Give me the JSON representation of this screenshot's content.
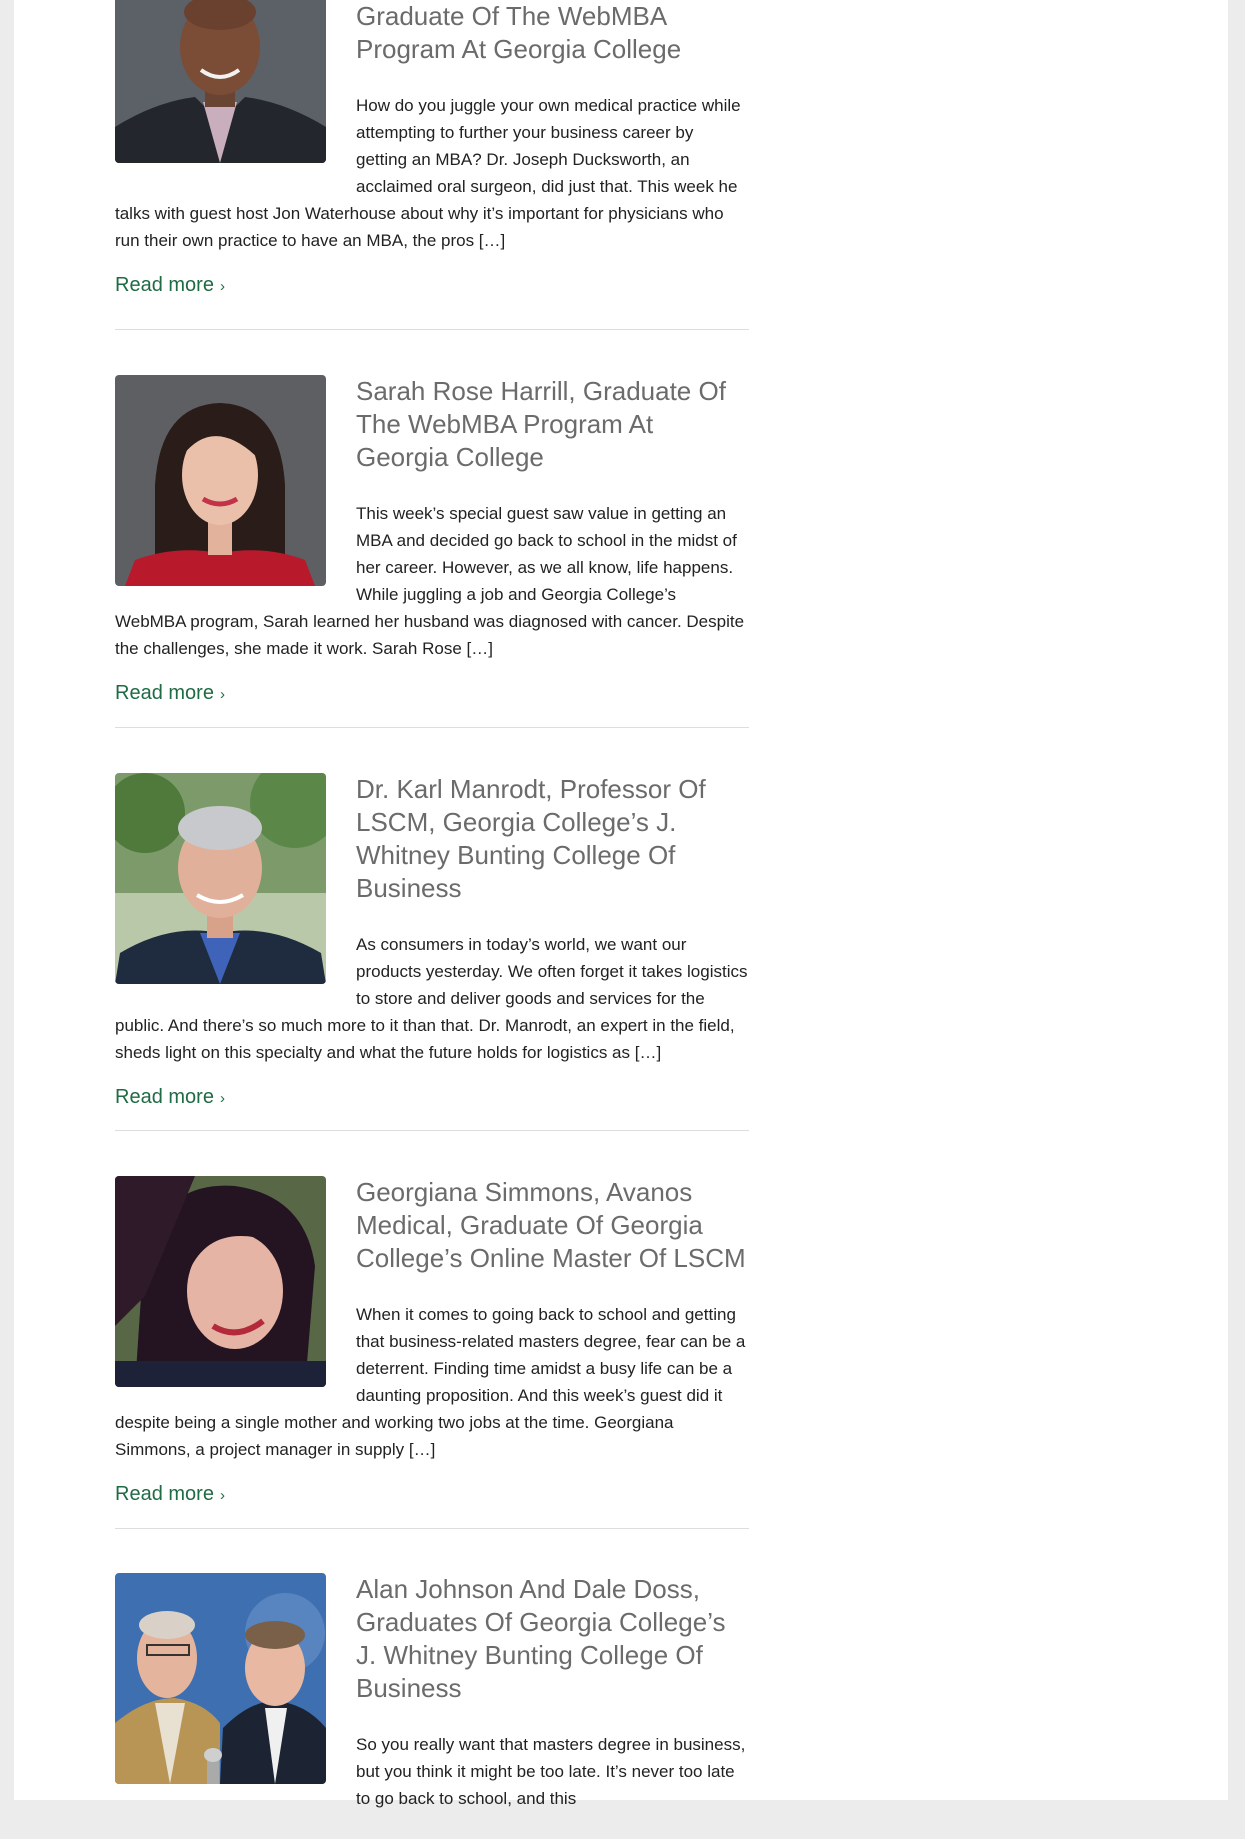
{
  "posts": [
    {
      "title": "Graduate Of The WebMBA Program At Georgia College",
      "excerpt": "How do you juggle your own medical practice while attempting to further your business career by getting an MBA? Dr. Joseph Ducksworth, an acclaimed oral surgeon, did just that. This week he talks with guest host Jon Waterhouse about why it’s important for physicians who run their own practice to have an MBA, the pros […]",
      "read_more": "Read more",
      "photo": "portrait-man-suit"
    },
    {
      "title": "Sarah Rose Harrill, Graduate Of The WebMBA Program At Georgia College",
      "excerpt": "This week’s special guest saw value in getting an MBA and decided go back to school in the midst of her career. However, as we all know, life happens. While juggling a job and Georgia College’s WebMBA program, Sarah learned her husband was diagnosed with cancer. Despite the challenges, she made it work. Sarah Rose […]",
      "read_more": "Read more",
      "photo": "portrait-woman-red"
    },
    {
      "title": "Dr. Karl Manrodt, Professor Of LSCM, Georgia College’s J. Whitney Bunting College Of Business",
      "excerpt": "As consumers in today’s world, we want our products yesterday. We often forget it takes logistics to store and deliver goods and services for the public. And there’s so much more to it than that. Dr. Manrodt, an expert in the field, sheds light on this specialty and what the future holds for logistics as […]",
      "read_more": "Read more",
      "photo": "portrait-man-outdoors"
    },
    {
      "title": "Georgiana Simmons, Avanos Medical, Graduate Of Georgia College’s Online Master Of LSCM",
      "excerpt": "When it comes to going back to school and getting that business-related masters degree, fear can be a deterrent. Finding time amidst a busy life can be a daunting proposition. And this week’s guest did it despite being a single mother and working two jobs at the time. Georgiana Simmons, a project manager in supply […]",
      "read_more": "Read more",
      "photo": "portrait-woman-smiling"
    },
    {
      "title": "Alan Johnson And Dale Doss, Graduates Of Georgia College’s J. Whitney Bunting College Of Business",
      "excerpt": "So you really want that masters degree in business, but you think it might be too late. It’s never too late to go back to school, and this",
      "read_more": "",
      "photo": "portrait-two-men"
    }
  ],
  "colors": {
    "accent_green": "#1f6b43",
    "title_gray": "#6b6b6b"
  }
}
